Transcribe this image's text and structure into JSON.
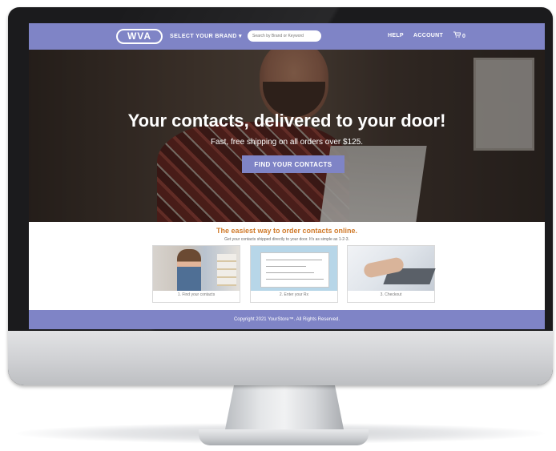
{
  "nav": {
    "logo_text": "WVA",
    "brand_select_label": "SELECT YOUR BRAND ▾",
    "search_placeholder": "Search by Brand or Keyword",
    "help_label": "HELP",
    "account_label": "ACCOUNT",
    "cart_count": "0"
  },
  "hero": {
    "title": "Your contacts, delivered to your door!",
    "subtitle": "Fast, free shipping on all orders over $125.",
    "cta_label": "FIND YOUR CONTACTS"
  },
  "steps": {
    "heading": "The easiest way to order contacts online.",
    "subheading": "Get your contacts shipped directly to your door. It's as simple as 1-2-3.",
    "items": [
      {
        "label": "1. Find your contacts"
      },
      {
        "label": "2. Enter your Rx"
      },
      {
        "label": "3. Checkout"
      }
    ]
  },
  "footer": {
    "copyright": "Copyright 2021 YourStore™. All Rights Reserved."
  },
  "colors": {
    "accent": "#7f84c6",
    "heading_orange": "#d07a2a"
  }
}
